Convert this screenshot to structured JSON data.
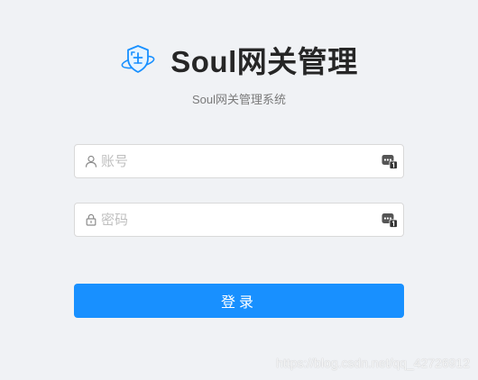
{
  "header": {
    "title": "Soul网关管理",
    "subtitle": "Soul网关管理系统",
    "logo_icon": "shield-logo-icon"
  },
  "form": {
    "username": {
      "placeholder": "账号",
      "value": "",
      "prefix_icon": "user-icon",
      "suffix_icon": "password-manager-icon"
    },
    "password": {
      "placeholder": "密码",
      "value": "",
      "prefix_icon": "lock-icon",
      "suffix_icon": "password-manager-icon"
    },
    "submit_label": "登录"
  },
  "watermark": "https://blog.csdn.net/qq_42726912",
  "colors": {
    "primary": "#1890ff",
    "background": "#f0f2f5",
    "title": "#262626",
    "subtitle": "#7a7a7a",
    "placeholder": "#bfbfbf",
    "border": "#d9d9d9"
  }
}
